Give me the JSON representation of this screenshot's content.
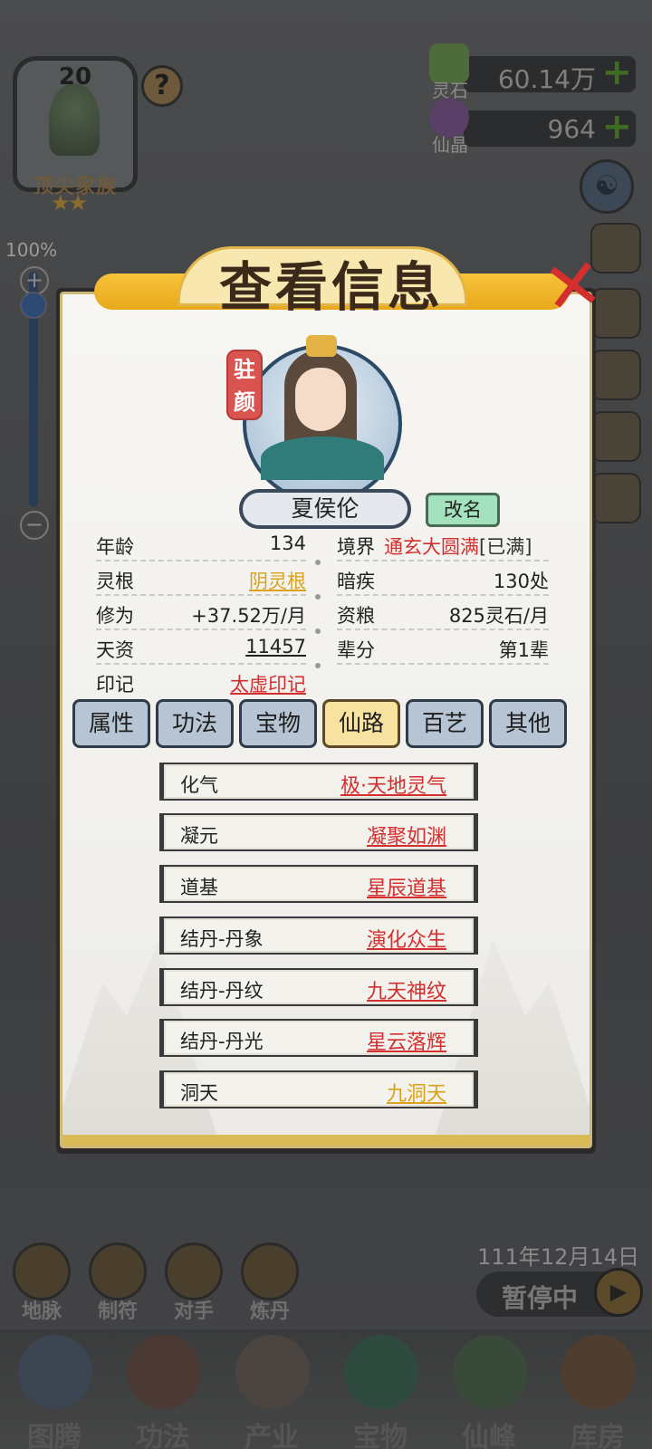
{
  "family": {
    "level": "20",
    "name": "顶尖家族",
    "stars": "★★",
    "help": "?"
  },
  "currencies": [
    {
      "label": "灵石",
      "value": "60.14万",
      "plus": "+",
      "icon": "spirit-stone-icon",
      "color": "#4e6b3a"
    },
    {
      "label": "仙晶",
      "value": "964",
      "plus": "+",
      "icon": "immortal-crystal-icon",
      "color": "#5a3f66"
    }
  ],
  "zoom": {
    "percent": "100%",
    "plus": "+",
    "minus": "−",
    "level": 1.0
  },
  "modal": {
    "title": "查看信息",
    "close": "✕",
    "seal": [
      "驻",
      "颜"
    ],
    "name": "夏侯伦",
    "rename": "改名",
    "info_left": [
      {
        "key": "年龄",
        "value": "134"
      },
      {
        "key": "灵根",
        "value": "阴灵根"
      },
      {
        "key": "修为",
        "value": "+37.52万/月"
      },
      {
        "key": "天资",
        "value": "11457"
      },
      {
        "key": "印记",
        "value": "太虚印记"
      }
    ],
    "info_right": [
      {
        "key": "境界",
        "value": "通玄大圆满",
        "suffix": "[已满]"
      },
      {
        "key": "暗疾",
        "value": "130处"
      },
      {
        "key": "资粮",
        "value": "825灵石/月"
      },
      {
        "key": "辈分",
        "value": "第1辈"
      }
    ],
    "tabs": [
      "属性",
      "功法",
      "宝物",
      "仙路",
      "百艺",
      "其他"
    ],
    "active_tab": "仙路",
    "paths": [
      {
        "key": "化气",
        "value": "极·天地灵气"
      },
      {
        "key": "凝元",
        "value": "凝聚如渊"
      },
      {
        "key": "道基",
        "value": "星辰道基"
      },
      {
        "key": "结丹-丹象",
        "value": "演化众生"
      },
      {
        "key": "结丹-丹纹",
        "value": "九天神纹"
      },
      {
        "key": "结丹-丹光",
        "value": "星云落辉"
      },
      {
        "key": "洞天",
        "value": "九洞天"
      }
    ]
  },
  "date": "111年12月14日",
  "pause": {
    "label": "暂停中",
    "icon": "play-icon"
  },
  "mini_dock": [
    "地脉",
    "制符",
    "对手",
    "炼丹"
  ],
  "bottom_nav": [
    "图腾",
    "功法",
    "产业",
    "宝物",
    "仙峰",
    "库房"
  ],
  "colors": {
    "accent_red": "#d32f2f",
    "gold": "#d9a21a",
    "tab_active": "#f8e2a0",
    "tab_inactive": "#b7c4d3"
  }
}
